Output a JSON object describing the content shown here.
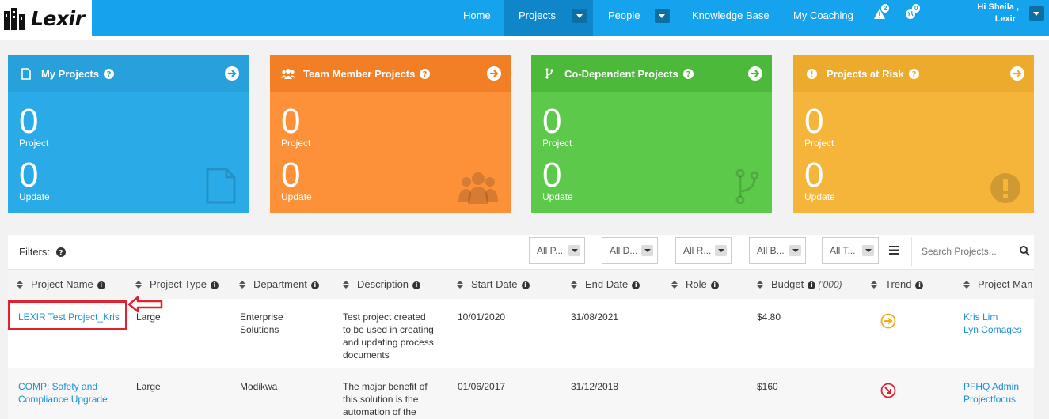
{
  "brand": {
    "name": "Lexir"
  },
  "nav": {
    "items": [
      {
        "label": "Home"
      },
      {
        "label": "Projects"
      },
      {
        "label": "People"
      },
      {
        "label": "Knowledge Base"
      },
      {
        "label": "My Coaching"
      }
    ],
    "alerts_count": "2",
    "globe_count": "0",
    "greeting_line1": "Hi Sheila ,",
    "greeting_line2": "Lexir"
  },
  "cards": [
    {
      "title": "My Projects",
      "color": "#2aabe8",
      "head_color": "#28a0db",
      "icon": "document-icon",
      "count": "0",
      "count_label": "Project",
      "updates": "0",
      "updates_label": "Update"
    },
    {
      "title": "Team Member Projects",
      "color": "#fc913a",
      "head_color": "#f27f25",
      "icon": "users-icon",
      "count": "0",
      "count_label": "Project",
      "updates": "0",
      "updates_label": "Update"
    },
    {
      "title": "Co-Dependent Projects",
      "color": "#5dc94b",
      "head_color": "#4cb93b",
      "icon": "branch-icon",
      "count": "0",
      "count_label": "Project",
      "updates": "0",
      "updates_label": "Update"
    },
    {
      "title": "Projects at Risk",
      "color": "#f5b53b",
      "head_color": "#ecab2c",
      "icon": "exclamation-icon",
      "count": "0",
      "count_label": "Project",
      "updates": "0",
      "updates_label": "Update"
    }
  ],
  "filters": {
    "label": "Filters:",
    "dropdowns": [
      "All P...",
      "All D...",
      "All R...",
      "All B...",
      "All T..."
    ],
    "search_placeholder": "Search Projects..."
  },
  "table": {
    "columns": [
      "Project Name",
      "Project Type",
      "Department",
      "Description",
      "Start Date",
      "End Date",
      "Role",
      "Budget",
      "Trend",
      "Project Man"
    ],
    "budget_unit": "('000)",
    "rows": [
      {
        "name": "LEXIR Test Project_Kris",
        "type": "Large",
        "department": [
          "Enterprise",
          "Solutions"
        ],
        "description": [
          "Test project created",
          "to be used in creating",
          "and updating process",
          "documents"
        ],
        "start": "10/01/2020",
        "end": "31/08/2021",
        "role": "",
        "budget": "$4.80",
        "trend": "steady",
        "managers": [
          "Kris Lim",
          "Lyn Comages"
        ]
      },
      {
        "name": [
          "COMP: Safety and",
          "Compliance Upgrade"
        ],
        "type": "Large",
        "department": [
          "Modikwa"
        ],
        "description": [
          "The major benefit of",
          "this solution is the",
          "automation of the"
        ],
        "start": "01/06/2017",
        "end": "31/12/2018",
        "role": "",
        "budget": "$160",
        "trend": "declining",
        "managers": [
          "PFHQ Admin",
          "Projectfocus"
        ]
      }
    ]
  }
}
